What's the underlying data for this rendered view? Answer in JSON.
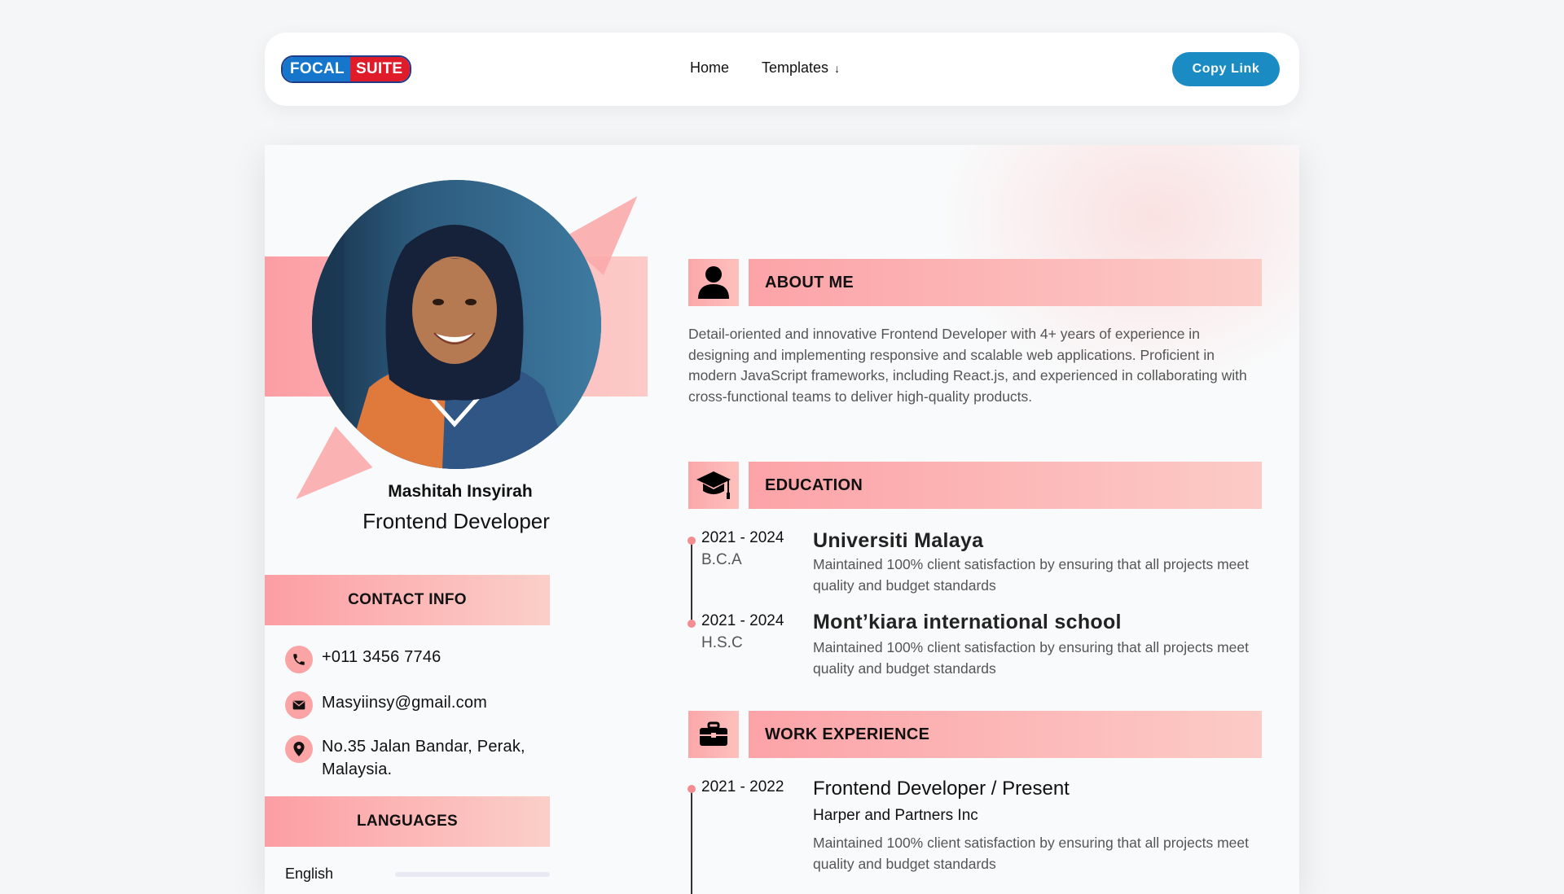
{
  "navbar": {
    "logo_left": "FOCAL",
    "logo_right": "SUITE",
    "links": [
      "Home",
      "Templates"
    ],
    "templates_arrow": "↓",
    "copy_link": "Copy Link"
  },
  "profile": {
    "name": "Mashitah Insyirah",
    "job_title": "Frontend Developer",
    "avatar_icon": "portrait-photo"
  },
  "contact": {
    "heading": "CONTACT INFO",
    "phone": "+011 3456 7746",
    "email": "Masyiinsy@gmail.com",
    "address_line1": "No.35 Jalan Bandar, Perak,",
    "address_line2": "Malaysia.",
    "icons": [
      "phone-icon",
      "mail-icon",
      "location-pin-icon"
    ]
  },
  "languages": {
    "heading": "LANGUAGES",
    "items": [
      {
        "name": "English"
      }
    ]
  },
  "about": {
    "heading": "ABOUT ME",
    "icon": "user-icon",
    "text": "Detail-oriented and innovative Frontend Developer with 4+ years of experience in designing and implementing responsive and scalable web applications. Proficient in modern JavaScript frameworks, including React.js, and experienced in collaborating with cross-functional teams to deliver high-quality products."
  },
  "education": {
    "heading": "EDUCATION",
    "icon": "graduation-cap-icon",
    "items": [
      {
        "years": "2021 - 2024",
        "degree": "B.C.A",
        "school": "Universiti Malaya",
        "desc": "Maintained 100% client satisfaction by ensuring that all projects meet quality and budget standards"
      },
      {
        "years": "2021 - 2024",
        "degree": "H.S.C",
        "school": "Mont’kiara international school",
        "desc": "Maintained 100% client satisfaction by ensuring that all projects meet quality and budget standards"
      }
    ]
  },
  "work": {
    "heading": "WORK EXPERIENCE",
    "icon": "briefcase-icon",
    "items": [
      {
        "years": "2021 - 2022",
        "title": "Frontend Developer / Present",
        "company": "Harper and Partners Inc",
        "desc": "Maintained 100% client satisfaction by ensuring that all projects meet quality and budget standards"
      }
    ]
  },
  "colors": {
    "accent_pink": "#fca3a8",
    "button_blue": "#1b8bc4"
  }
}
